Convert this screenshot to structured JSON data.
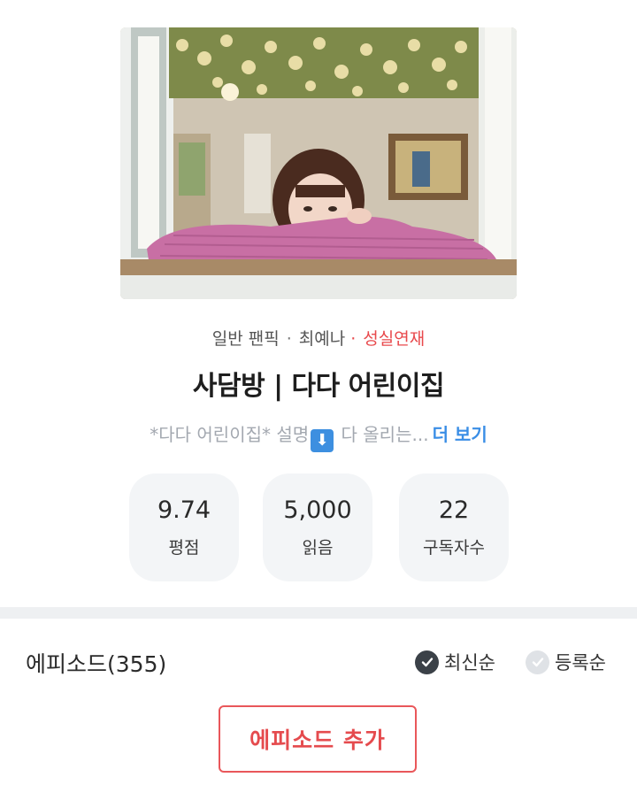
{
  "meta": {
    "category": "일반 팬픽",
    "author": "최예나",
    "status": "성실연재"
  },
  "title": "사담방 | 다다 어린이집",
  "description": {
    "text_before": "*다다 어린이집* 설명",
    "emoji": "⬇",
    "text_after": " 다 올리는...",
    "more_label": "더 보기"
  },
  "stats": [
    {
      "value": "9.74",
      "label": "평점"
    },
    {
      "value": "5,000",
      "label": "읽음"
    },
    {
      "value": "22",
      "label": "구독자수"
    }
  ],
  "episodes": {
    "title": "에피소드(355)",
    "sort_latest": "최신순",
    "sort_registered": "등록순",
    "sort_selected": "최신순",
    "add_button": "에피소드 추가"
  },
  "colors": {
    "accent_red": "#e8494c",
    "link_blue": "#3a8ee6",
    "stat_bg": "#f3f5f7"
  }
}
